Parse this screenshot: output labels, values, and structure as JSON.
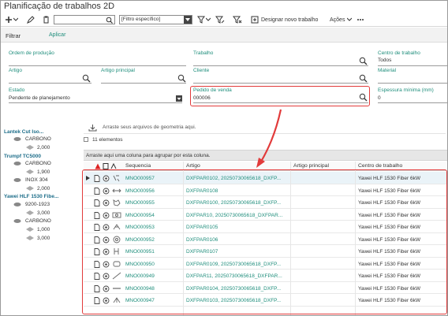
{
  "window": {
    "title": "Planificação de trabalhos 2D"
  },
  "toolbar": {
    "search_value": "",
    "filter_select": "[Filtro específico]",
    "designar_label": "Designar novo trabalho",
    "acoes_label": "Ações"
  },
  "subbar": {
    "filtrar": "Filtrar",
    "aplicar": "Aplicar"
  },
  "filters": {
    "ordem_producao": {
      "label": "Ordem de produção",
      "value": ""
    },
    "trabalho": {
      "label": "Trabalho",
      "value": ""
    },
    "centro_trabalho": {
      "label": "Centro de trabalho",
      "value": "Todos"
    },
    "artigo": {
      "label": "Artigo",
      "value": ""
    },
    "artigo_principal": {
      "label": "Artigo principal",
      "value": ""
    },
    "cliente": {
      "label": "Cliente",
      "value": ""
    },
    "material": {
      "label": "Material",
      "value": ""
    },
    "estado": {
      "label": "Estado",
      "value": "Pendente de planejamento"
    },
    "pedido_venda": {
      "label": "Pedido de venda",
      "value": "000006"
    },
    "espessura": {
      "label": "Espessura mínima (mm)",
      "value": "0"
    }
  },
  "tree": [
    {
      "machine": "Lantek Cut Iso...",
      "materials": [
        {
          "name": "CARBONO",
          "thickness": "2,000"
        }
      ]
    },
    {
      "machine": "Trumpf TC5000",
      "materials": [
        {
          "name": "CARBONO",
          "thickness": "1,900"
        },
        {
          "name": "INOX 304",
          "thickness": "2,000"
        }
      ]
    },
    {
      "machine": "Yawei HLF 1530 Fibe...",
      "materials": [
        {
          "name": "9200-1923",
          "thickness": "3,000"
        },
        {
          "name": "CARBONO",
          "thickness": "1,000"
        },
        {
          "name": "",
          "thickness": "3,000"
        }
      ]
    }
  ],
  "grid": {
    "dropzone_text": "Arraste seus arquivos de geometria aqui.",
    "element_count": "11 elementos",
    "group_hint": "Arraste aqui uma coluna para agrupar por esta coluna.",
    "columns": [
      "Sequencia",
      "Artigo",
      "Artigo principal",
      "Centro de trabalho"
    ],
    "rows": [
      {
        "seq": "MNO000957",
        "artigo": "DXFPAR0102, 20250730065618_DXFP...",
        "principal": "",
        "centro": "Yawei HLF 1530 Fiber 6kW"
      },
      {
        "seq": "MNO000956",
        "artigo": "DXFPAR0108",
        "principal": "",
        "centro": "Yawei HLF 1530 Fiber 6kW"
      },
      {
        "seq": "MNO000955",
        "artigo": "DXFPAR0100, 20250730065618_DXFP...",
        "principal": "",
        "centro": "Yawei HLF 1530 Fiber 6kW"
      },
      {
        "seq": "MNO000954",
        "artigo": "DXFPAR10, 20250730065618_DXFPAR...",
        "principal": "",
        "centro": "Yawei HLF 1530 Fiber 6kW"
      },
      {
        "seq": "MNO000953",
        "artigo": "DXFPAR0105",
        "principal": "",
        "centro": "Yawei HLF 1530 Fiber 6kW"
      },
      {
        "seq": "MNO000952",
        "artigo": "DXFPAR0106",
        "principal": "",
        "centro": "Yawei HLF 1530 Fiber 6kW"
      },
      {
        "seq": "MNO000951",
        "artigo": "DXFPAR0107",
        "principal": "",
        "centro": "Yawei HLF 1530 Fiber 6kW"
      },
      {
        "seq": "MNO000950",
        "artigo": "DXFPAR0109, 20250730065618_DXFP...",
        "principal": "",
        "centro": "Yawei HLF 1530 Fiber 6kW"
      },
      {
        "seq": "MNO000949",
        "artigo": "DXFPAR11, 20250730065618_DXFPAR...",
        "principal": "",
        "centro": "Yawei HLF 1530 Fiber 6kW"
      },
      {
        "seq": "MNO000948",
        "artigo": "DXFPAR0104, 20250730065618_DXFP...",
        "principal": "",
        "centro": "Yawei HLF 1530 Fiber 6kW"
      },
      {
        "seq": "MNO000947",
        "artigo": "DXFPAR0103, 20250730065618_DXFP...",
        "principal": "",
        "centro": "Yawei HLF 1530 Fiber 6kW"
      }
    ]
  },
  "colors": {
    "accent": "#1f8e7c",
    "highlight": "#e23b3b",
    "tree_root": "#1e6e8a"
  }
}
